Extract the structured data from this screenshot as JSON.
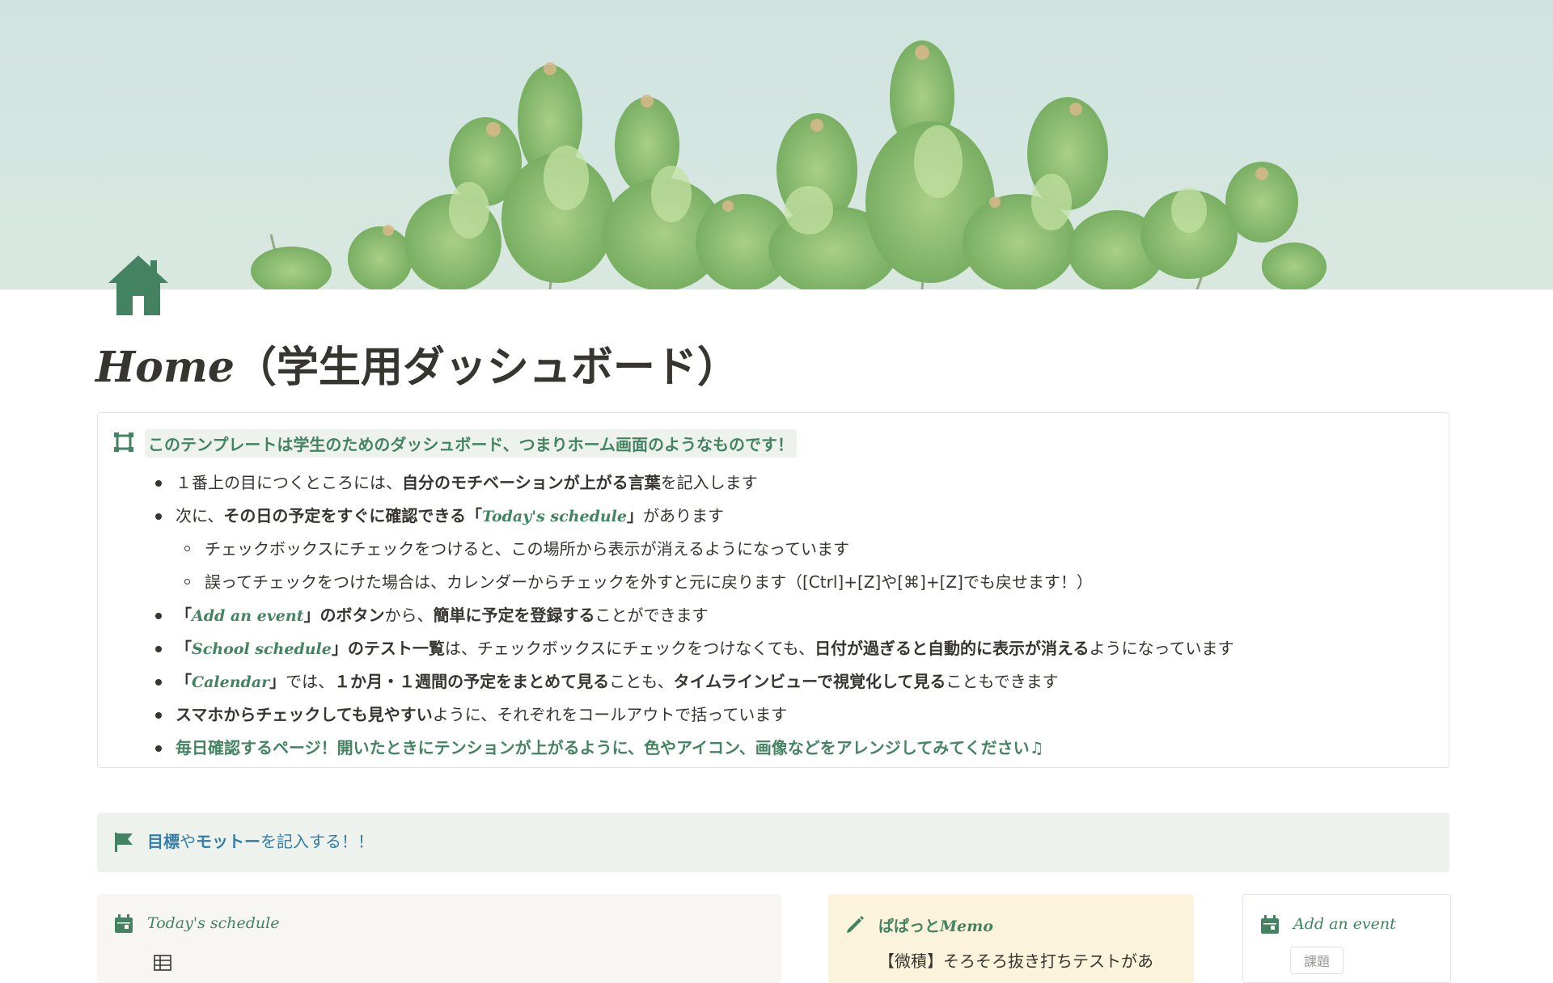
{
  "colors": {
    "accent_green": "#448361",
    "accent_blue": "#337ea9",
    "callout_green_bg": "#edf3ec",
    "memo_bg": "#fbf3db",
    "gray_bg": "#f7f6f3"
  },
  "page": {
    "icon": "house-icon",
    "title_en": "Home",
    "title_ja": "（学生用ダッシュボード）"
  },
  "info_callout": {
    "icon": "template-frame-icon",
    "headline": "このテンプレートは学生のためのダッシュボード、つまりホーム画面のようなものです！",
    "bullets": {
      "b1": {
        "p1": "１番上の目につくところには、",
        "b1": "自分のモチベーションが上がる言葉",
        "p2": "を記入します"
      },
      "b2": {
        "p1": "次に、",
        "b1": "その日の予定をすぐに確認できる「",
        "it": "Today's schedule",
        "b2": "」",
        "p2": "があります"
      },
      "b3": {
        "p1": "チェックボックスにチェックをつけると、この場所から表示が消えるようになっています"
      },
      "b4": {
        "p1": "誤ってチェックをつけた場合は、カレンダーからチェックを外すと元に戻ります（[Ctrl]+[Z]や[⌘]+[Z]でも戻せます！）"
      },
      "b5": {
        "b1": "「",
        "it": "Add an event",
        "b2": "」のボタン",
        "p1": "から、",
        "b3": "簡単に予定を登録する",
        "p2": "ことができます"
      },
      "b6": {
        "b1": "「",
        "it": "School schedule",
        "b2": "」のテスト一覧",
        "p1": "は、チェックボックスにチェックをつけなくても、",
        "b3": "日付が過ぎると自動的に表示が消える",
        "p2": "ようになっています"
      },
      "b7": {
        "b1": "「",
        "it": "Calendar",
        "b2": "」",
        "p1": "では、",
        "b3": "１か月・１週間の予定をまとめて見る",
        "p2": "ことも、",
        "b4": "タイムラインビューで視覚化して見る",
        "p3": "こともできます"
      },
      "b8": {
        "b1": "スマホからチェックしても見やすい",
        "p1": "ように、それぞれをコールアウトで括っています"
      },
      "b9": {
        "g1": "毎日確認するページ！開いたときにテンションが上がるように、色やアイコン、画像などをアレンジしてみてください♫"
      }
    }
  },
  "goal_callout": {
    "icon": "flag-icon",
    "b1": "目標",
    "p1": "や",
    "b2": "モットー",
    "p2": "を記入する！！"
  },
  "cards": {
    "today": {
      "icon": "calendar-icon",
      "title": "Today's schedule",
      "sub_icon": "table-icon"
    },
    "memo": {
      "icon": "pencil-icon",
      "title_ja": "ぱぱっと",
      "title_en": "Memo",
      "line": "【微積】そろそろ抜き打ちテストがあ"
    },
    "add": {
      "icon": "calendar-icon",
      "title": "Add an event",
      "tag": "課題"
    }
  }
}
